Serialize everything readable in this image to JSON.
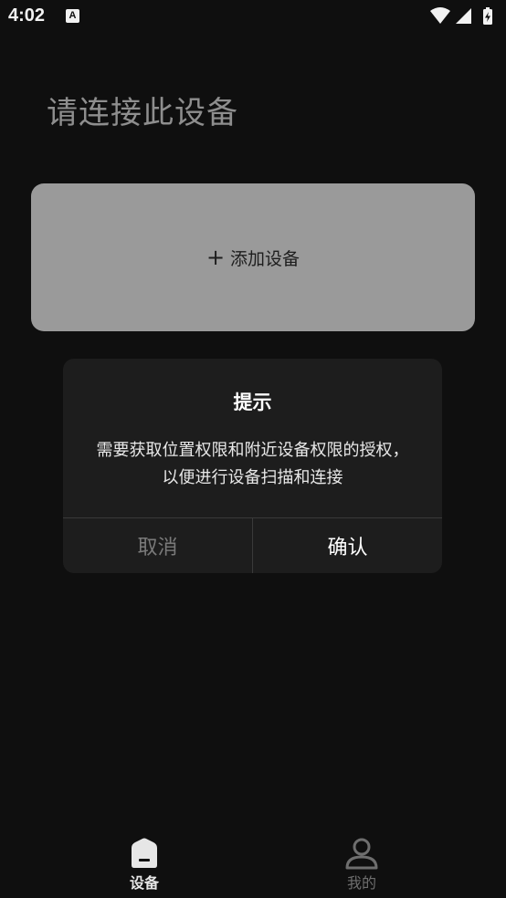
{
  "status_bar": {
    "time": "4:02",
    "notification_icon_letter": "A",
    "icons": [
      "wifi-icon",
      "signal-icon",
      "battery-charging-icon"
    ]
  },
  "page": {
    "title": "请连接此设备"
  },
  "add_card": {
    "icon": "plus-icon",
    "plus_glyph": "+",
    "label": "添加设备"
  },
  "dialog": {
    "title": "提示",
    "message": "需要获取位置权限和附近设备权限的授权，以便进行设备扫描和连接",
    "cancel_label": "取消",
    "confirm_label": "确认"
  },
  "tab_bar": {
    "tabs": [
      {
        "label": "设备",
        "icon": "device-icon",
        "active": true
      },
      {
        "label": "我的",
        "icon": "person-icon",
        "active": false
      }
    ]
  },
  "colors": {
    "background": "#0f0f0f",
    "card": "#9a9a9a",
    "dialog": "#1d1d1d",
    "title_gray": "#8e8e8e",
    "cancel_gray": "#7a7a7a"
  }
}
